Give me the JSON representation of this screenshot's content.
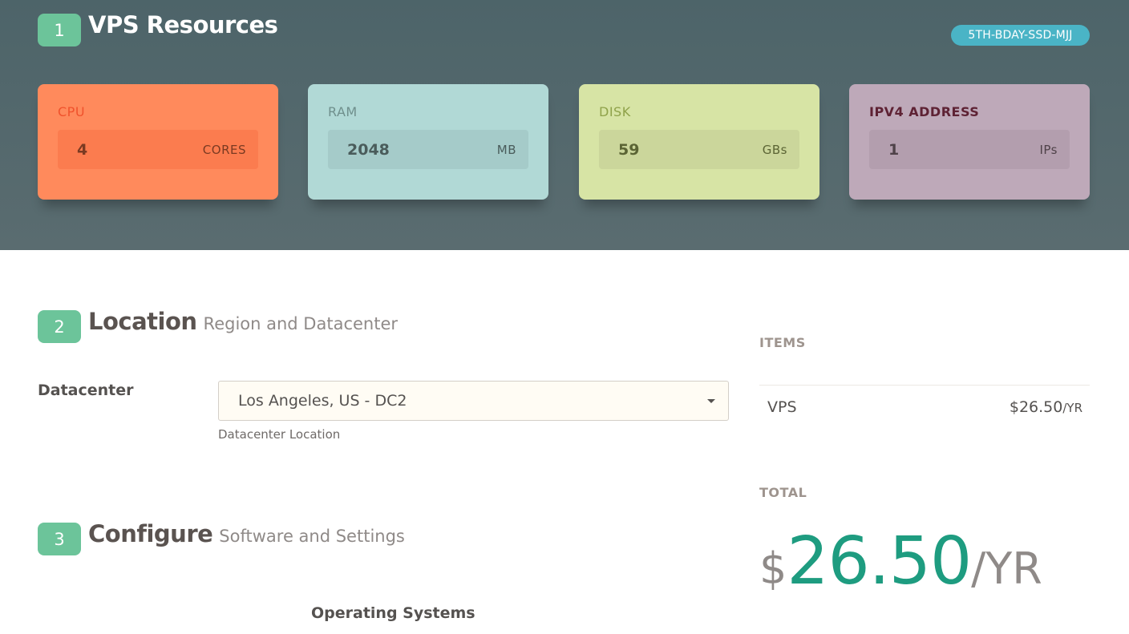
{
  "resources": {
    "step": "1",
    "title": "VPS Resources",
    "promo_code": "5TH-BDAY-SSD-MJJ",
    "cards": [
      {
        "label": "CPU",
        "value": "4",
        "unit": "CORES"
      },
      {
        "label": "RAM",
        "value": "2048",
        "unit": "MB"
      },
      {
        "label": "DISK",
        "value": "59",
        "unit": "GBs"
      },
      {
        "label": "IPV4 ADDRESS",
        "value": "1",
        "unit": "IPs"
      }
    ]
  },
  "location": {
    "step": "2",
    "title": "Location",
    "subtitle": "Region and Datacenter",
    "datacenter_label": "Datacenter",
    "datacenter_selected": "Los Angeles, US - DC2",
    "datacenter_help": "Datacenter Location"
  },
  "configure": {
    "step": "3",
    "title": "Configure",
    "subtitle": "Software and Settings",
    "os_heading": "Operating Systems"
  },
  "summary": {
    "items_label": "ITEMS",
    "items": [
      {
        "name": "VPS",
        "price": "$26.50",
        "period": "/YR"
      }
    ],
    "total_label": "TOTAL",
    "total_currency": "$",
    "total_amount": "26.50",
    "total_period": "/YR"
  },
  "colors": {
    "accent_green": "#6cc49a",
    "total_green": "#1e9c80",
    "promo_blue": "#4ab4c6",
    "cpu": "#ff8a5c",
    "ram": "#b1d9d6",
    "disk": "#d7e4a5",
    "ipv4": "#bea9b9"
  }
}
